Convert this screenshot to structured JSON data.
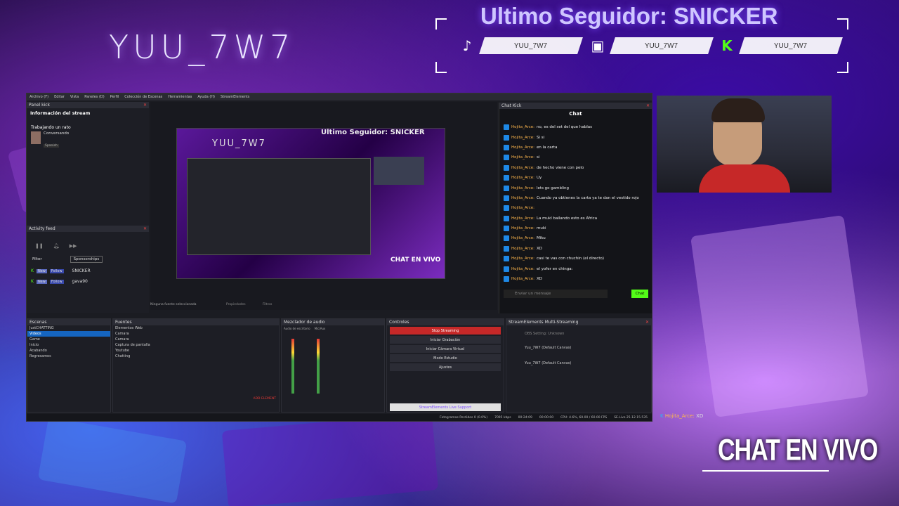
{
  "overlay": {
    "channel_title": "YUU_7W7",
    "last_follower": "Ultimo Seguidor: SNICKER",
    "socials": [
      {
        "icon": "tiktok-icon",
        "handle": "YUU_7W7",
        "color": "#000000"
      },
      {
        "icon": "twitch-icon",
        "handle": "YUU_7W7",
        "color": "#9146ff"
      },
      {
        "icon": "kick-icon",
        "handle": "YUU_7W7",
        "color": "#53fc18"
      }
    ],
    "chat_en_vivo": "CHAT EN VIVO",
    "bottom_chat_user": "Hojita_Arce:",
    "bottom_chat_msg": "XD"
  },
  "obs": {
    "menu": [
      "Archivo (F)",
      "Editar",
      "Vista",
      "Paneles (D)",
      "Perfil",
      "Colección de Escenas",
      "Herramientas",
      "Ayuda (H)",
      "StreamElements"
    ],
    "panel_kick": "Panel kick",
    "stream_info_title": "Información del stream",
    "stream_status": "Trabajando un rato",
    "stream_category": "Conversando",
    "stream_language": "Spanish",
    "activity_feed": "Activity feed",
    "filter_label": "Filter",
    "sponsorships_label": "Sponsorships",
    "activity": [
      {
        "badge": "New",
        "type": "Follow",
        "user": "SNICKER"
      },
      {
        "badge": "New",
        "type": "Follow",
        "user": "gava90"
      }
    ],
    "no_source": "Ninguna fuente seleccionada",
    "properties": "Propiedades",
    "filters": "Filtros",
    "preview_follower": "Ultimo Seguidor: SNICKER",
    "preview_title": "YUU_7W7",
    "preview_chat": "CHAT EN VIVO",
    "chat_kick": "Chat Kick",
    "chat_title": "Chat",
    "chat_messages": [
      {
        "user": "Hojita_Arce:",
        "text": "no, es del set del que hablas"
      },
      {
        "user": "Hojita_Arce:",
        "text": "Si si"
      },
      {
        "user": "Hojita_Arce:",
        "text": "en la carta"
      },
      {
        "user": "Hojita_Arce:",
        "text": "si"
      },
      {
        "user": "Hojita_Arce:",
        "text": "de hecho viene con pelo"
      },
      {
        "user": "Hojita_Arce:",
        "text": "Uy"
      },
      {
        "user": "Hojita_Arce:",
        "text": "lets go gambling"
      },
      {
        "user": "Hojita_Arce:",
        "text": "Cuando ya obtienes la carta ya te dan el vestido rojo"
      },
      {
        "user": "Hojita_Arce:",
        "text": ""
      },
      {
        "user": "Hojita_Arce:",
        "text": "La mukl bailando esto es Africa"
      },
      {
        "user": "Hojita_Arce:",
        "text": "muki"
      },
      {
        "user": "Hojita_Arce:",
        "text": "Miku"
      },
      {
        "user": "Hojita_Arce:",
        "text": "XD"
      },
      {
        "user": "Hojita_Arce:",
        "text": "casi te vas con chuchin (el directo)"
      },
      {
        "user": "Hojita_Arce:",
        "text": "el yofer en chinga:"
      },
      {
        "user": "Hojita_Arce:",
        "text": "XD"
      }
    ],
    "chat_placeholder": "Enviar un mensaje",
    "chat_button": "Chat",
    "scenes_title": "Escenas",
    "scenes": [
      "JustCHATTING",
      "Videos",
      "Game",
      "Inicio",
      "Acabando",
      "Regresamos"
    ],
    "sources_title": "Fuentes",
    "sources": [
      "Elementos Web",
      "Camara",
      "Camara",
      "Captura de pantalla",
      "Youtube",
      "Chatting"
    ],
    "mixer_title": "Mezclador de audio",
    "mixer_channels": [
      "Audio de escritorio",
      "Mic/Aux"
    ],
    "controls_title": "Controles",
    "controls": [
      "Stop Streaming",
      "Iniciar Grabación",
      "Iniciar Cámara Virtual",
      "Modo Estudio",
      "Ajustes"
    ],
    "se_title": "StreamElements Multi-Streaming",
    "se_rows": [
      "OBS Setting: Unknown",
      "Yuu_7W7 (Default Canvas)",
      "Yuu_7W7 (Default Canvas)"
    ],
    "se_support": "StreamElements Live Support",
    "add_element": "ADD ELEMENT",
    "status": [
      "Fotogramas Perdidos 0 (0.0%)",
      "7095 kbps",
      "00:24:09",
      "00:00:00",
      "CPU: 4.6%, 60.00 / 60.00 FPS",
      "SE.Live 25.12.15.535"
    ]
  }
}
